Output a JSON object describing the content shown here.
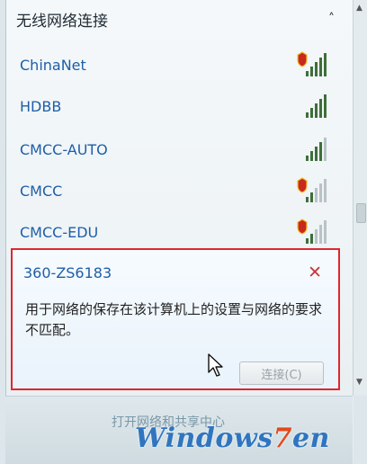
{
  "panel": {
    "title": "无线网络连接",
    "collapse_glyph": "˄"
  },
  "networks": [
    {
      "name": "ChinaNet",
      "secured": true,
      "bars": 5
    },
    {
      "name": "HDBB",
      "secured": false,
      "bars": 5
    },
    {
      "name": "CMCC-AUTO",
      "secured": false,
      "bars": 4
    },
    {
      "name": "CMCC",
      "secured": true,
      "bars": 2
    },
    {
      "name": "CMCC-EDU",
      "secured": true,
      "bars": 2
    }
  ],
  "selected": {
    "name": "360-ZS6183",
    "close_glyph": "✕",
    "message": "用于网络的保存在该计算机上的设置与网络的要求不匹配。",
    "connect_label": "连接(C)"
  },
  "scrollbar": {
    "up_glyph": "▲",
    "down_glyph": "▼"
  },
  "footer": {
    "open_link": "打开网络和共享中心"
  },
  "watermark": {
    "text_a": "Windows",
    "text_b": "7",
    "text_c": "en"
  },
  "colors": {
    "link": "#1e5ea8",
    "highlight_border": "#e0262b",
    "shield_red": "#c8281e",
    "shield_yellow": "#f2c230",
    "bar": "#3e6f3a"
  }
}
